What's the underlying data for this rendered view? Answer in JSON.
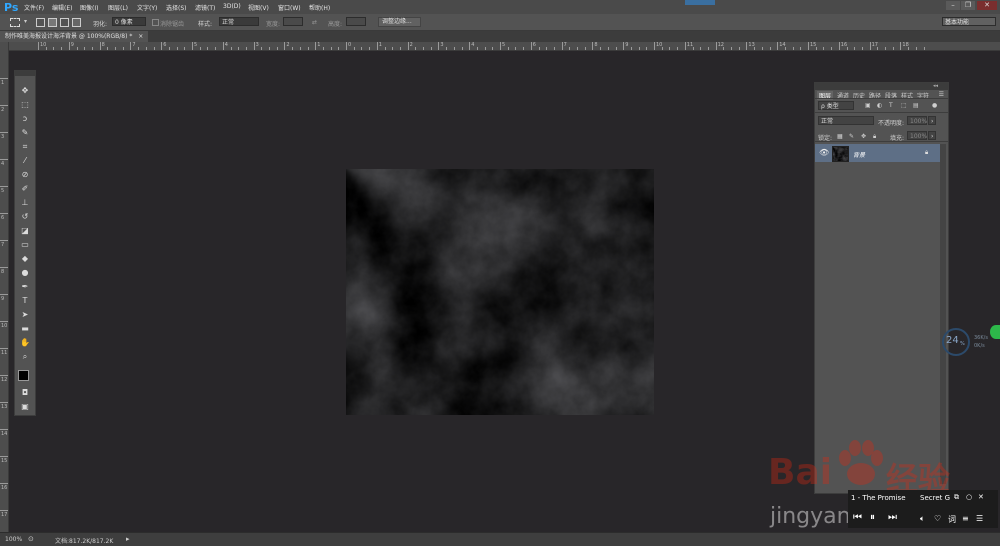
{
  "app": {
    "logo": "Ps"
  },
  "menu": [
    "文件(F)",
    "编辑(E)",
    "图像(I)",
    "图层(L)",
    "文字(Y)",
    "选择(S)",
    "滤镜(T)",
    "3D(D)",
    "视图(V)",
    "窗口(W)",
    "帮助(H)"
  ],
  "window_controls": {
    "minimize": "–",
    "restore": "❐",
    "close": "✕"
  },
  "options": {
    "feather_label": "羽化:",
    "feather_value": "0 像素",
    "antialias_label": "消除锯齿",
    "style_label": "样式:",
    "style_value": "正常",
    "width_label": "宽度:",
    "height_label": "高度:",
    "refine_edge": "调整边缘...",
    "workspace": "基本功能"
  },
  "document": {
    "tab_title": "制作唯美海报设计海洋背景 @ 100%(RGB/8) *",
    "close": "×"
  },
  "ruler": {
    "h_labels": [
      "11",
      "10",
      "9",
      "8",
      "7",
      "6",
      "5",
      "4",
      "3",
      "2",
      "1",
      "0",
      "1",
      "2",
      "3",
      "4",
      "5",
      "6",
      "7",
      "8",
      "9",
      "10",
      "11",
      "12",
      "13",
      "14",
      "15",
      "16",
      "17",
      "18"
    ],
    "v_labels": [
      "1",
      "2",
      "3",
      "4",
      "5",
      "6",
      "7",
      "8",
      "9",
      "10",
      "11",
      "12",
      "13",
      "14",
      "15",
      "16",
      "17",
      "18",
      "19"
    ]
  },
  "layers_panel": {
    "tabs": [
      "图层",
      "通道",
      "历史",
      "路径",
      "段落",
      "样式",
      "字符"
    ],
    "filter_kind": "ρ 类型",
    "blend_mode": "正常",
    "opacity_label": "不透明度:",
    "opacity_value": "100%",
    "lock_label": "锁定:",
    "fill_label": "填充:",
    "fill_value": "100%",
    "layer_name": "背景"
  },
  "status": {
    "zoom": "100%",
    "doc_info": "文档:817.2K/817.2K"
  },
  "music_player": {
    "track1": "1 - The Promise",
    "track2": "Secret G"
  },
  "speed_widget": {
    "value": "24",
    "unit": "%",
    "line1": "36K/s",
    "line2": "0K/s"
  },
  "watermark": {
    "logo_text": "Bai",
    "logo_text2": "经验",
    "url": "jingyan.baidu.com"
  },
  "colors": {
    "app_bg": "#282629",
    "panel": "#535353",
    "selected_layer": "#5e6f86",
    "ps_blue": "#31a8ff",
    "baidu_red": "#de2910"
  }
}
